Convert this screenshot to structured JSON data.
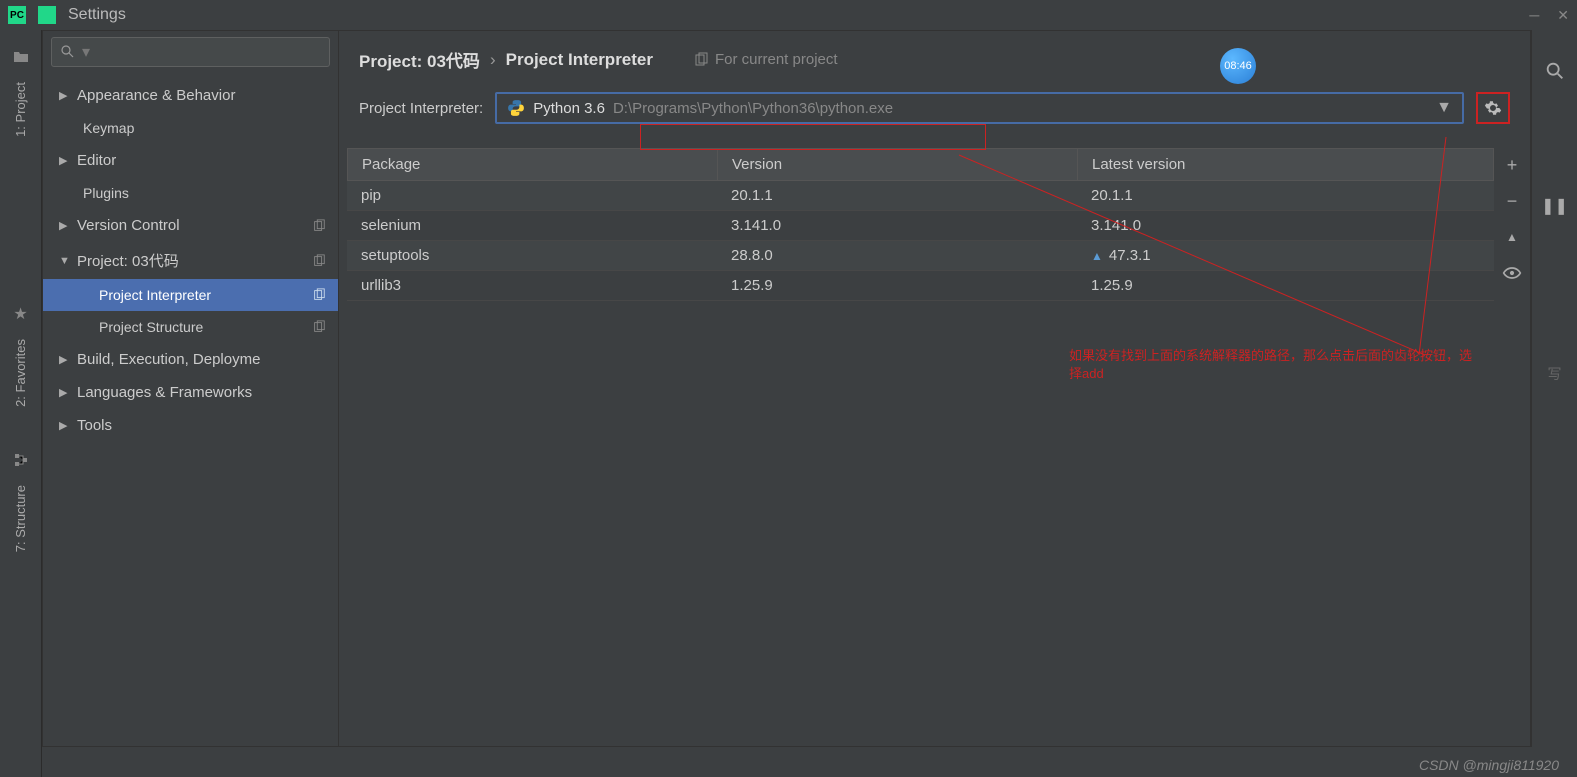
{
  "window": {
    "title": "Settings",
    "close_tooltip": "Close",
    "minimize_tooltip": "Minimize"
  },
  "sidebar_tool_tabs": {
    "project": "1: Project",
    "favorites": "2: Favorites",
    "structure": "7: Structure"
  },
  "right_strip": {
    "search_tooltip": "Search",
    "pause_tooltip": "Pause"
  },
  "nav": {
    "items": [
      {
        "label": "Appearance & Behavior",
        "type": "expand"
      },
      {
        "label": "Keymap",
        "type": "leaf"
      },
      {
        "label": "Editor",
        "type": "expand"
      },
      {
        "label": "Plugins",
        "type": "leaf"
      },
      {
        "label": "Version Control",
        "type": "expand",
        "copy": true
      },
      {
        "label": "Project: 03代码",
        "type": "expanded",
        "copy": true
      },
      {
        "label": "Project Interpreter",
        "type": "sub",
        "copy": true,
        "selected": true
      },
      {
        "label": "Project Structure",
        "type": "sub",
        "copy": true
      },
      {
        "label": "Build, Execution, Deployme",
        "type": "expand"
      },
      {
        "label": "Languages & Frameworks",
        "type": "expand"
      },
      {
        "label": "Tools",
        "type": "expand"
      }
    ]
  },
  "breadcrumb": {
    "main": "Project: 03代码",
    "separator": "›",
    "sub": "Project Interpreter",
    "for_current": "For current project"
  },
  "interpreter": {
    "label": "Project Interpreter:",
    "name": "Python 3.6",
    "path": "D:\\Programs\\Python\\Python36\\python.exe",
    "gear_tooltip": "Settings"
  },
  "packages": {
    "headers": {
      "name": "Package",
      "version": "Version",
      "latest": "Latest version"
    },
    "rows": [
      {
        "name": "pip",
        "version": "20.1.1",
        "latest": "20.1.1",
        "upgrade": false
      },
      {
        "name": "selenium",
        "version": "3.141.0",
        "latest": "3.141.0",
        "upgrade": false
      },
      {
        "name": "setuptools",
        "version": "28.8.0",
        "latest": "47.3.1",
        "upgrade": true
      },
      {
        "name": "urllib3",
        "version": "1.25.9",
        "latest": "1.25.9",
        "upgrade": false
      }
    ],
    "side_btns": {
      "add": "+",
      "remove": "−",
      "up": "▲",
      "show": "◉"
    }
  },
  "clock": "08:46",
  "annotation": {
    "text": "如果没有找到上面的系统解释器的路径，那么点击后面的齿轮按钮，选择add"
  },
  "watermark": "CSDN @mingji811920"
}
